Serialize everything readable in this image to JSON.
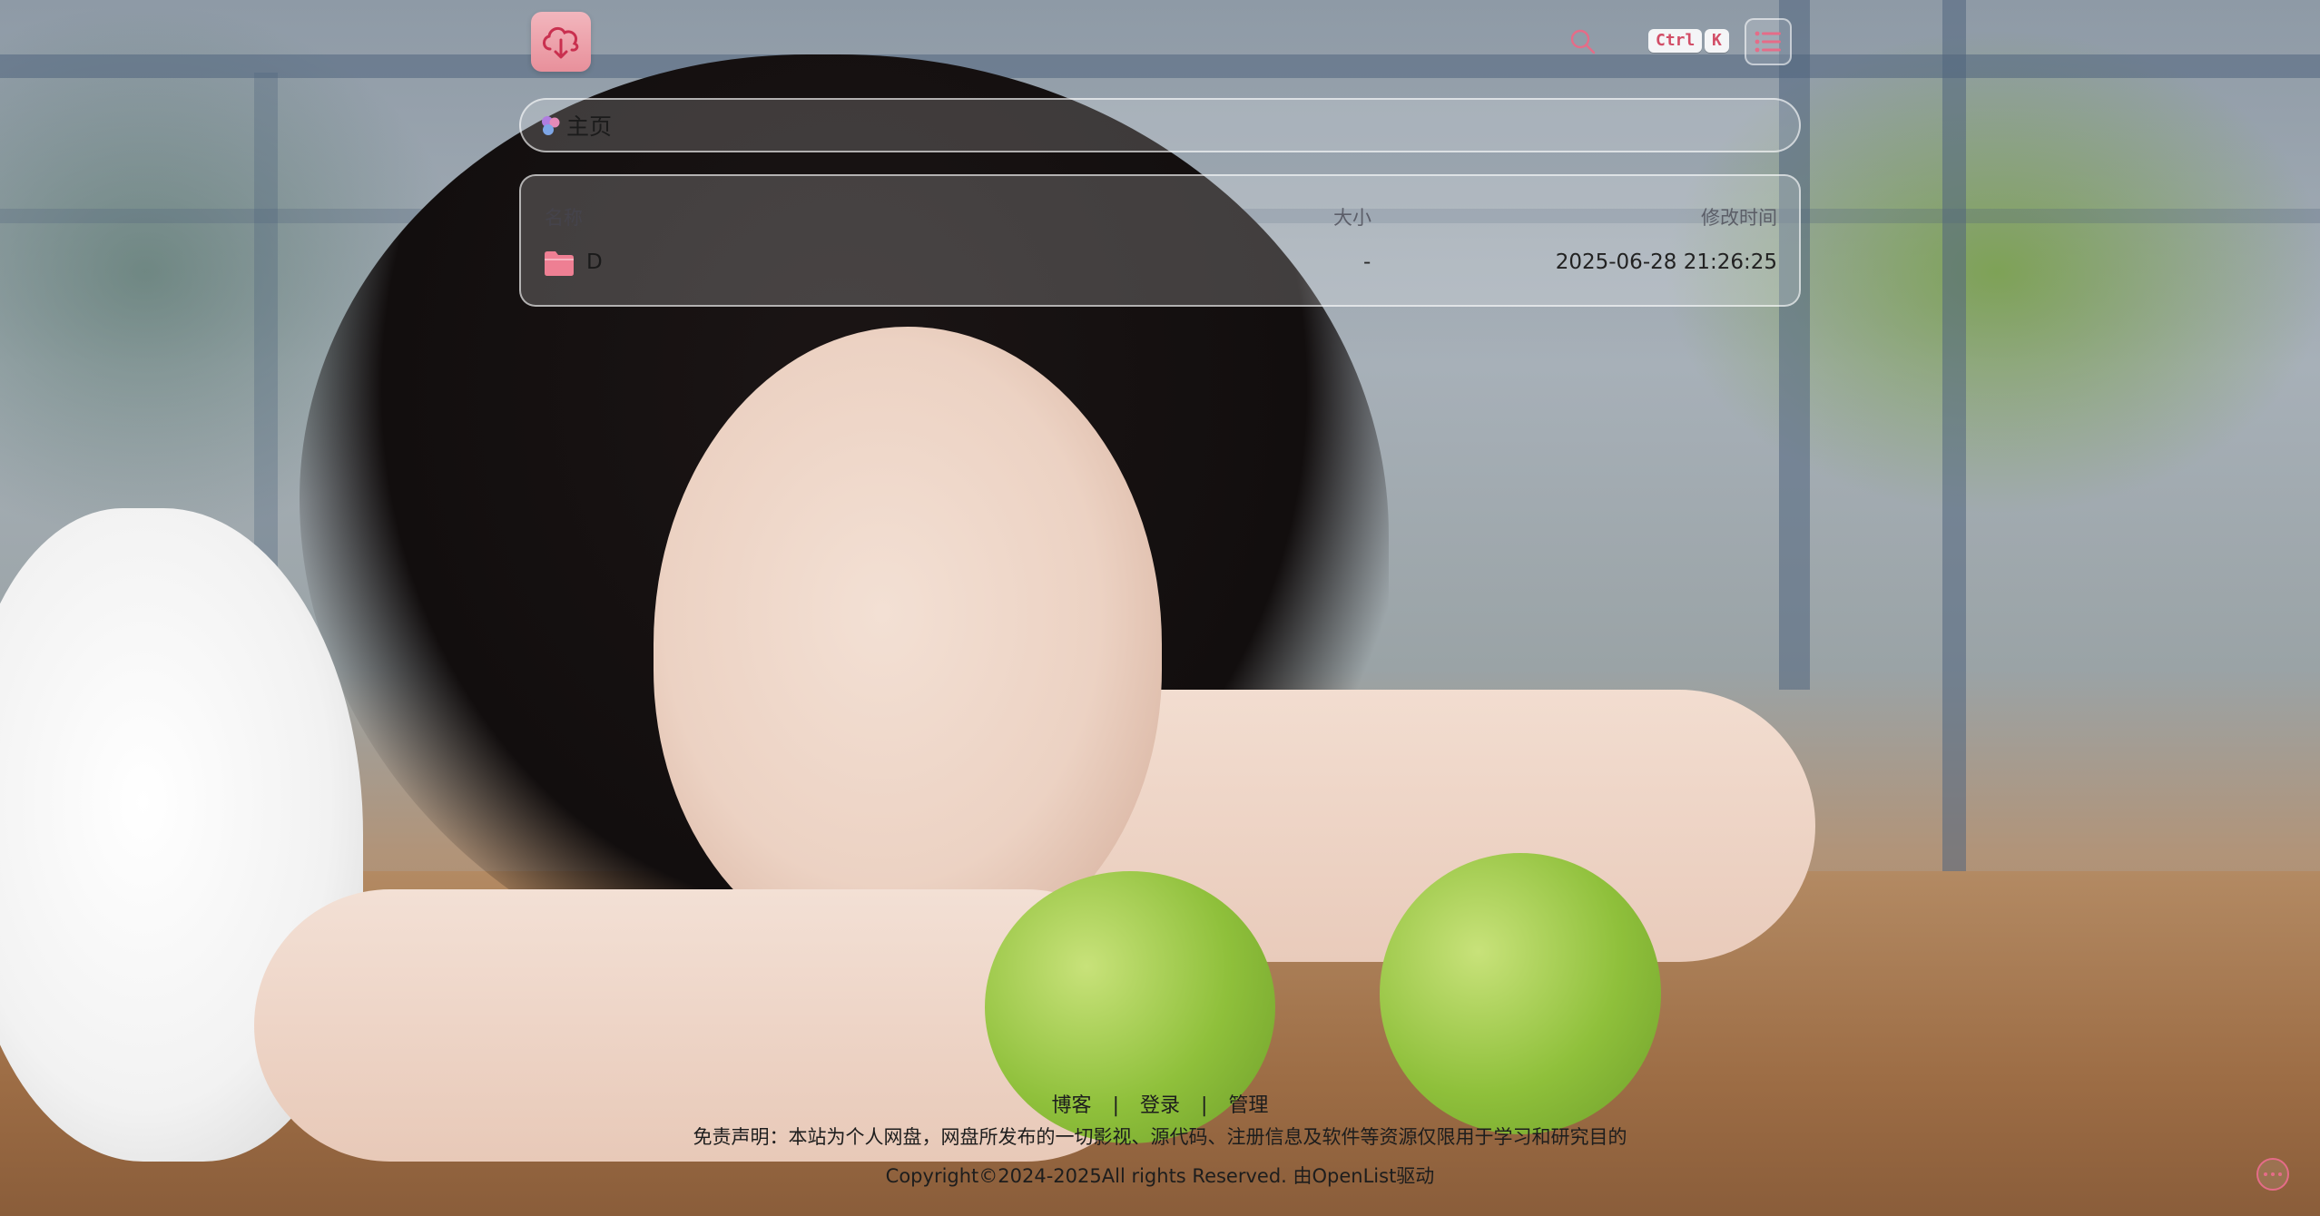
{
  "header": {
    "logo_alt": "logo",
    "search": {
      "shortcut_ctrl": "Ctrl",
      "shortcut_key": "K"
    }
  },
  "breadcrumb": {
    "home_label": "主页"
  },
  "file_list": {
    "columns": {
      "name": "名称",
      "size": "大小",
      "modified": "修改时间"
    },
    "rows": [
      {
        "name": "D",
        "size": "-",
        "modified": "2025-06-28 21:26:25"
      }
    ]
  },
  "footer": {
    "links": [
      "博客",
      "登录",
      "管理"
    ],
    "separator": "|",
    "disclaimer": "免责声明：本站为个人网盘，网盘所发布的一切影视、源代码、注册信息及软件等资源仅限用于学习和研究目的",
    "copyright": "Copyright©2024-2025All rights Reserved. 由OpenList驱动"
  },
  "colors": {
    "accent": "#e56c88",
    "logo_bg": "#ee9fa9",
    "folder": "#ee7f93"
  }
}
